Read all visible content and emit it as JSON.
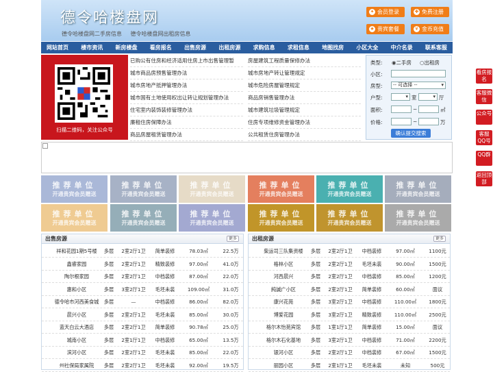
{
  "header": {
    "title": "德令哈楼盘网",
    "sub_links": [
      "德令哈楼盘网二手房信息",
      "德令哈楼盘网出租房信息"
    ],
    "buttons": [
      {
        "label": "会员登录",
        "icon": "user-icon",
        "glyph": "✦"
      },
      {
        "label": "免费注册",
        "icon": "register-icon",
        "glyph": "✚"
      },
      {
        "label": "贵宾套餐",
        "icon": "vip-icon",
        "glyph": "★"
      },
      {
        "label": "金币充值",
        "icon": "coin-icon",
        "glyph": "¥"
      }
    ]
  },
  "nav": [
    "网站首页",
    "楼市资讯",
    "新房楼盘",
    "看房报名",
    "出售房源",
    "出租房源",
    "求购信息",
    "求租信息",
    "地图找房",
    "小区大全",
    "中介名录",
    "联系客服"
  ],
  "qr": {
    "caption": "扫描二维码，关注公众号"
  },
  "policy_links": [
    "已购公有住房和经济适用住房上市出售管理暂",
    "房屋建筑工程质量保修办法",
    "城市商品房预售管理办法",
    "城市房地产转让管理规定",
    "城市房地产抵押管理办法",
    "城市危险房屋管理规定",
    "城市国有土地使用权出让转让规划管理办法",
    "商品房销售管理办法",
    "住宅室内装饰装修管理办法",
    "城市建筑垃圾管理规定",
    "廉租住房保障办法",
    "住房专项维修资金管理办法",
    "商品房屋租赁管理办法",
    "公共租赁住房管理办法"
  ],
  "search": {
    "type_label": "类型:",
    "opt_sale": "二手房",
    "opt_rent": "出租房",
    "district_label": "小区:",
    "district_value": "",
    "house_type_label": "房型:",
    "house_type_value": "-- 可选择 --",
    "layout_label": "户型:",
    "room_unit": "室",
    "hall_unit": "厅",
    "area_label": "面积:",
    "area_unit": "㎡",
    "price_label": "价格:",
    "price_unit": "万",
    "range_sep": "~",
    "submit": "确认提交搜索"
  },
  "recommend": {
    "line1": "推荐单位",
    "line2": "开通贵宾会员赠送",
    "colors": [
      "#aab8d8",
      "#a7b2c6",
      "#e6dbc7",
      "#e47f5e",
      "#4ab0b0",
      "#a5adbc",
      "#efcb92",
      "#95aeb8",
      "#a3a9d1",
      "#c19529",
      "#c0942e",
      "#aaaaaa"
    ]
  },
  "sale": {
    "title": "出售房源",
    "more": "更多",
    "rows": [
      [
        "祥和花园1期5号楼",
        "多层",
        "2室2厅1卫",
        "简单装修",
        "78.03㎡",
        "22.5万"
      ],
      [
        "鑫睿家园",
        "多层",
        "2室2厅1卫",
        "精致装修",
        "97.00㎡",
        "41.0万"
      ],
      [
        "陶尔根家园",
        "多层",
        "2室2厅1卫",
        "中档装修",
        "87.00㎡",
        "22.0万"
      ],
      [
        "惠和小区",
        "多层",
        "3室2厅1卫",
        "毛坯未装",
        "109.00㎡",
        "31.0万"
      ],
      [
        "德令哈市河西美食城",
        "多层",
        "—",
        "中档装修",
        "86.00㎡",
        "82.0万"
      ],
      [
        "晨兴小区",
        "多层",
        "2室2厅1卫",
        "毛坯未装",
        "85.00㎡",
        "30.0万"
      ],
      [
        "蓝天白云大酒店",
        "多层",
        "2室2厅1卫",
        "简单装修",
        "90.78㎡",
        "25.0万"
      ],
      [
        "城南小区",
        "多层",
        "2室1厅1卫",
        "中档装修",
        "65.00㎡",
        "13.5万"
      ],
      [
        "滨河小区",
        "多层",
        "2室2厅1卫",
        "毛坯未装",
        "85.00㎡",
        "22.0万"
      ],
      [
        "州社保局家属院",
        "多层",
        "2室2厅1卫",
        "毛坯未装",
        "92.00㎡",
        "19.5万"
      ]
    ]
  },
  "rent": {
    "title": "出租房源",
    "more": "更多",
    "rows": [
      [
        "柴运司三队集资楼",
        "多层",
        "2室2厅1卫",
        "中档装修",
        "97.00㎡",
        "1100元"
      ],
      [
        "格林小区",
        "多层",
        "2室2厅1卫",
        "毛坯未装",
        "90.00㎡",
        "1500元"
      ],
      [
        "河西晨兴",
        "多层",
        "2室2厅1卫",
        "中档装修",
        "85.00㎡",
        "1200元"
      ],
      [
        "純誠广小区",
        "多层",
        "2室2厅1卫",
        "简单装修",
        "60.00㎡",
        "面议"
      ],
      [
        "康兴花苑",
        "多层",
        "3室2厅1卫",
        "中档装修",
        "110.00㎡",
        "1800元"
      ],
      [
        "博爱花园",
        "多层",
        "3室2厅1卫",
        "精致装修",
        "110.00㎡",
        "2500元"
      ],
      [
        "格尔木怡苑宾馆",
        "多层",
        "1室1厅1卫",
        "简单装修",
        "15.00㎡",
        "面议"
      ],
      [
        "格尔木石化基地",
        "多层",
        "3室2厅1卫",
        "中档装修",
        "71.00㎡",
        "2200元"
      ],
      [
        "银河小区",
        "多层",
        "2室2厅1卫",
        "中档装修",
        "67.00㎡",
        "1500元"
      ],
      [
        "丽园小区",
        "多层",
        "2室1厅1卫",
        "毛坯未装",
        "未知",
        "500元"
      ]
    ]
  },
  "side": [
    "看房报名",
    "客服微信",
    "公众号",
    "客服QQ号",
    "QQ群",
    "返回顶部"
  ]
}
